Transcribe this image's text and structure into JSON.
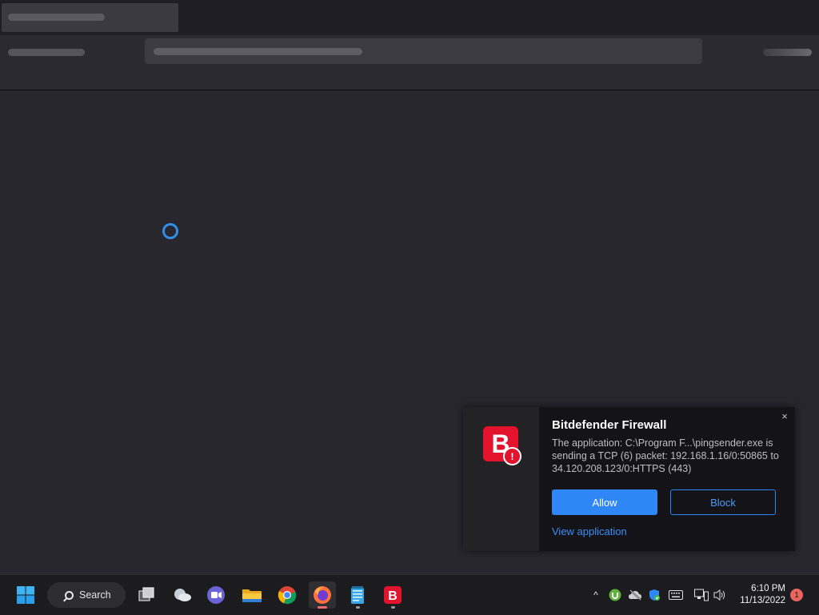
{
  "notification": {
    "app": "Bitdefender",
    "title": "Bitdefender Firewall",
    "message": "The application: C:\\Program F...\\pingsender.exe is sending a TCP (6) packet: 192.168.1.16/0:50865 to 34.120.208.123/0:HTTPS (443)",
    "allow_label": "Allow",
    "block_label": "Block",
    "view_link": "View application",
    "close_glyph": "×",
    "logo_letter": "B",
    "alert_glyph": "!",
    "accent": "#2f87f6",
    "brand_color": "#e3132d"
  },
  "taskbar": {
    "search_label": "Search",
    "pinned": [
      "windows-start-icon",
      "task-view-icon",
      "widgets-icon",
      "teams-chat-icon",
      "file-explorer-icon",
      "chrome-icon",
      "firefox-icon",
      "notepad-icon",
      "bitdefender-icon"
    ],
    "tray": {
      "chevron": "^",
      "time": "6:10 PM",
      "date": "11/13/2022",
      "notification_count": "1"
    }
  }
}
